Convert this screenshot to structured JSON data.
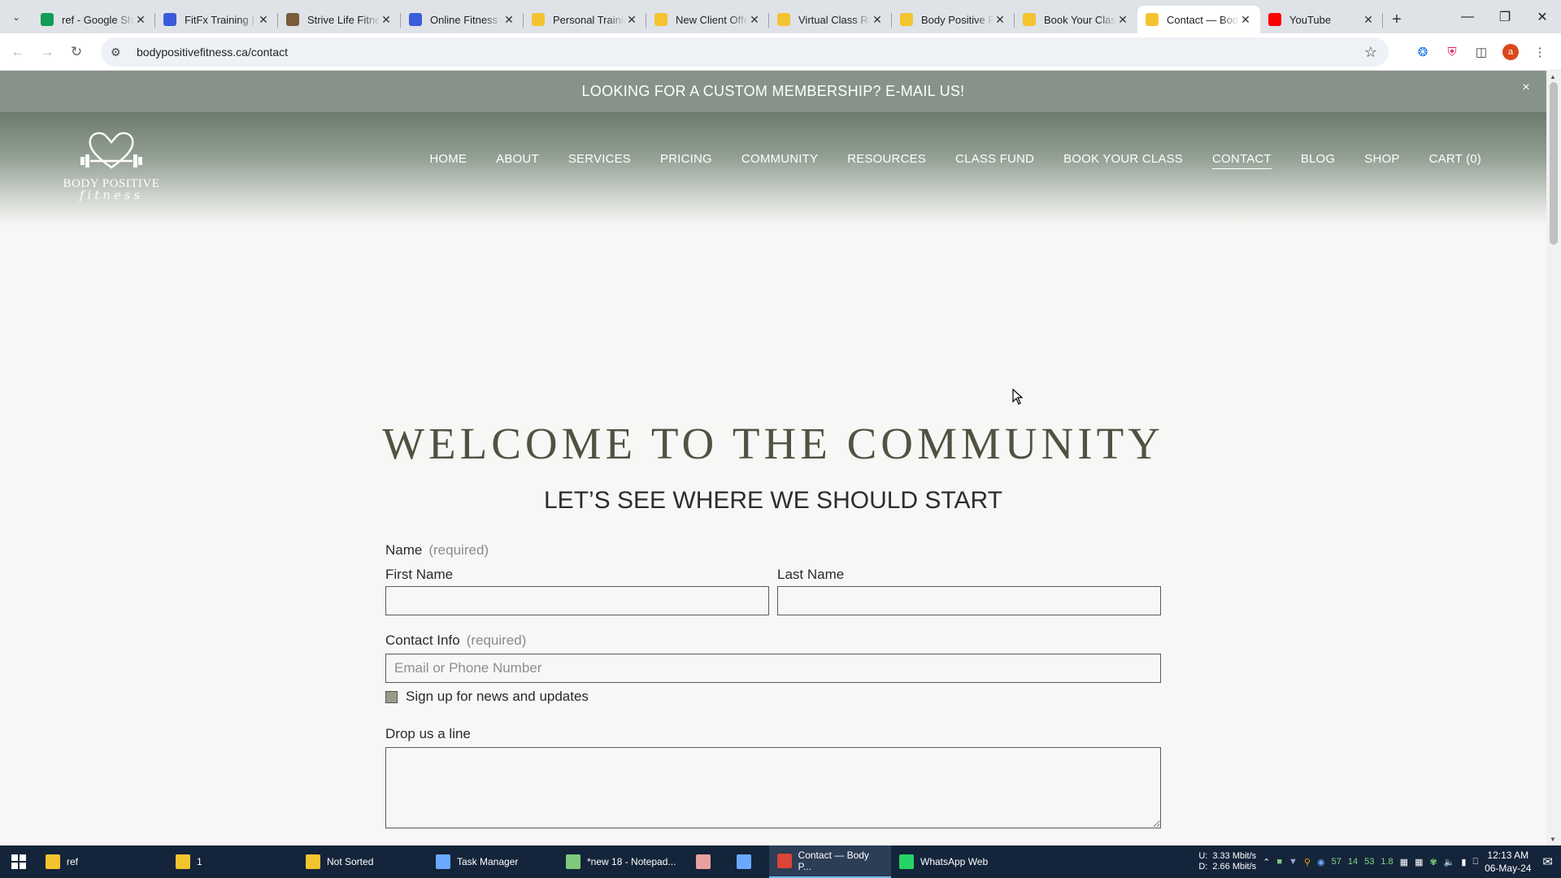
{
  "browser": {
    "tabs": [
      {
        "title": "ref - Google Sheets",
        "favicon": "sheets-icon",
        "color": "#0f9d58"
      },
      {
        "title": "FitFx Training | Online",
        "favicon": "fitfx-icon",
        "color": "#3b5bdb"
      },
      {
        "title": "Strive Life Fitness",
        "favicon": "strive-icon",
        "color": "#7a5c3a"
      },
      {
        "title": "Online Fitness Classes",
        "favicon": "online-fitness-icon",
        "color": "#3b5bdb"
      },
      {
        "title": "Personal Training",
        "favicon": "folder-icon",
        "color": "#f4c430"
      },
      {
        "title": "New Client Offer",
        "favicon": "folder-icon",
        "color": "#f4c430"
      },
      {
        "title": "Virtual Class Rates",
        "favicon": "folder-icon",
        "color": "#f4c430"
      },
      {
        "title": "Body Positive Fitness",
        "favicon": "folder-icon",
        "color": "#f4c430"
      },
      {
        "title": "Book Your Class",
        "favicon": "folder-icon",
        "color": "#f4c430"
      },
      {
        "title": "Contact — Body Positive",
        "favicon": "folder-icon",
        "color": "#f4c430",
        "active": true
      },
      {
        "title": "YouTube",
        "favicon": "youtube-icon",
        "color": "#ff0000"
      }
    ],
    "url": "bodypositivefitness.ca/contact",
    "profile_initial": "a"
  },
  "site": {
    "announcement": "LOOKING FOR A CUSTOM MEMBERSHIP? E-MAIL US!",
    "close_label": "×",
    "logo": {
      "line1": "BODY POSITIVE",
      "line2": "fitness"
    },
    "nav": [
      "HOME",
      "ABOUT",
      "SERVICES",
      "PRICING",
      "COMMUNITY",
      "RESOURCES",
      "CLASS FUND",
      "BOOK YOUR CLASS",
      "CONTACT",
      "BLOG",
      "SHOP",
      "CART (0)"
    ],
    "current_nav": "CONTACT",
    "title": "WELCOME TO THE COMMUNITY",
    "subtitle": "LET’S SEE WHERE WE SHOULD START"
  },
  "form": {
    "name_label": "Name",
    "required": "(required)",
    "first_name_label": "First Name",
    "last_name_label": "Last Name",
    "contact_label": "Contact Info",
    "contact_placeholder": "Email or Phone Number",
    "newsletter_label": "Sign up for news and updates",
    "message_label": "Drop us a line"
  },
  "taskbar": {
    "items": [
      {
        "label": "ref",
        "icon": "folder-icon"
      },
      {
        "label": "1",
        "icon": "folder-icon"
      },
      {
        "label": "Not Sorted",
        "icon": "folder-icon"
      },
      {
        "label": "Task Manager",
        "icon": "task-manager-icon"
      },
      {
        "label": "*new 18 - Notepad...",
        "icon": "notepad-icon"
      },
      {
        "label": "",
        "icon": "app-icon"
      },
      {
        "label": "",
        "icon": "document-icon"
      },
      {
        "label": "Contact — Body P...",
        "icon": "chrome-icon",
        "active": true
      },
      {
        "label": "WhatsApp Web",
        "icon": "whatsapp-icon"
      }
    ],
    "net_up": "U:",
    "net_down": "D:",
    "up_speed": "3.33 Mbit/s",
    "down_speed": "2.66 Mbit/s",
    "tray_numbers": [
      "57",
      "14",
      "53",
      "1.8"
    ],
    "time": "12:13 AM",
    "date": "06-May-24"
  }
}
